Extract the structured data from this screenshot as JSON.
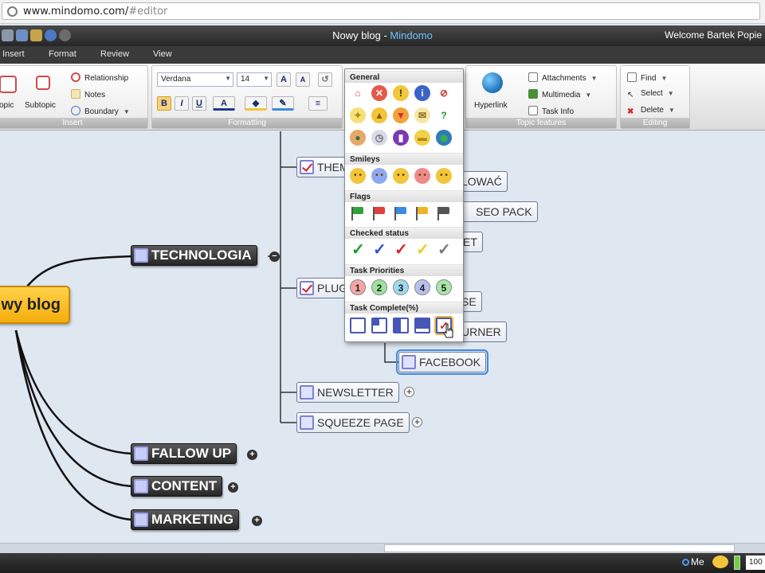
{
  "browser": {
    "url_host": "www.mindomo.com/",
    "url_hash": "#editor"
  },
  "titlebar": {
    "doc_title": "Nowy blog - ",
    "app_name": "Mindomo",
    "welcome": "Welcome Bartek Popie"
  },
  "tabs": [
    "Insert",
    "Format",
    "Review",
    "View"
  ],
  "ribbon": {
    "insert": {
      "label": "Insert",
      "topic": "opic",
      "subtopic": "Subtopic",
      "relationship": "Relationship",
      "notes": "Notes",
      "boundary": "Boundary"
    },
    "formatting": {
      "label": "Formatting",
      "font": "Verdana",
      "size": "14",
      "bold": "B",
      "italic": "I",
      "underline": "U"
    },
    "topic_features": {
      "label": "Topic features",
      "hyperlink": "Hyperlink",
      "attachments": "Attachments",
      "multimedia": "Multimedia",
      "task_info": "Task Info"
    },
    "editing": {
      "label": "Editing",
      "find": "Find",
      "select": "Select",
      "delete": "Delete"
    }
  },
  "mindmap": {
    "central": "wy blog",
    "technologia": "TECHNOLOGIA",
    "fallow_up": "FALLOW UP",
    "content": "CONTENT",
    "marketing": "MARKETING",
    "themes": "THEM",
    "plugins": "PLUG",
    "lowac": "LOWAĆ",
    "seo_pack": "SEO PACK",
    "et": "ET",
    "se": "SE",
    "urner": "URNER",
    "facebook": "FACEBOOK",
    "newsletter": "NEWSLETTER",
    "squeeze_page": "SQUEEZE PAGE",
    "expand": "+",
    "collapse": "−"
  },
  "icon_popup": {
    "general": "General",
    "smileys": "Smileys",
    "flags": "Flags",
    "checked_status": "Checked status",
    "task_priorities": "Task Priorities",
    "task_complete": "Task Complete(%)",
    "priorities": [
      "1",
      "2",
      "3",
      "4",
      "5"
    ],
    "general_icons": [
      "home-icon",
      "stop-icon",
      "warning-icon",
      "info-icon",
      "forbidden-icon",
      "bulb-icon",
      "thumbs-up-icon",
      "thumbs-down-icon",
      "mail-icon",
      "question-icon",
      "person-icon",
      "clock-icon",
      "phone-icon",
      "book-icon",
      "globe-icon"
    ],
    "flag_colors": [
      "#2fa33a",
      "#e0403a",
      "#3a8ce0",
      "#f0b429",
      "#555555"
    ],
    "check_colors": [
      "#1b9b2b",
      "#2f54c9",
      "#d02a2a",
      "#e8d01a",
      "#7a7a7a"
    ],
    "priority_colors": [
      "#f4a6a6",
      "#9ee29e",
      "#9fd9ee",
      "#b9bff0",
      "#a9e6a9"
    ],
    "smiley_colors": [
      "#f2c53a",
      "#8fa9f0",
      "#f2c53a",
      "#f08a8a",
      "#f2c53a"
    ],
    "task_complete_levels": [
      0,
      0.25,
      0.5,
      0.75,
      1
    ]
  },
  "status": {
    "me": "Me",
    "zoom": "100"
  }
}
